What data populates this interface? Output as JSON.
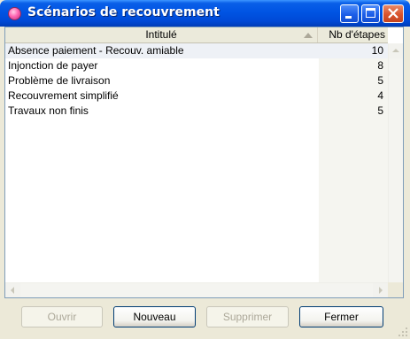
{
  "window": {
    "title": "Scénarios de recouvrement"
  },
  "table": {
    "columns": [
      "Intitulé",
      "Nb d'étapes"
    ],
    "sort_indicator": "sort-ascending-icon",
    "rows": [
      {
        "title": "Absence paiement - Recouv. amiable",
        "steps": "10"
      },
      {
        "title": "Injonction de payer",
        "steps": "8"
      },
      {
        "title": "Problème de livraison",
        "steps": "5"
      },
      {
        "title": "Recouvrement simplifié",
        "steps": "4"
      },
      {
        "title": "Travaux non finis",
        "steps": "5"
      }
    ]
  },
  "buttons": {
    "open": {
      "label": "Ouvrir",
      "enabled": false
    },
    "new": {
      "label": "Nouveau",
      "enabled": true
    },
    "delete": {
      "label": "Supprimer",
      "enabled": false
    },
    "close": {
      "label": "Fermer",
      "enabled": true
    }
  },
  "colors": {
    "titlebar": "#0054e3",
    "close_button": "#d9532c",
    "selected_row": "#eef1f6"
  }
}
